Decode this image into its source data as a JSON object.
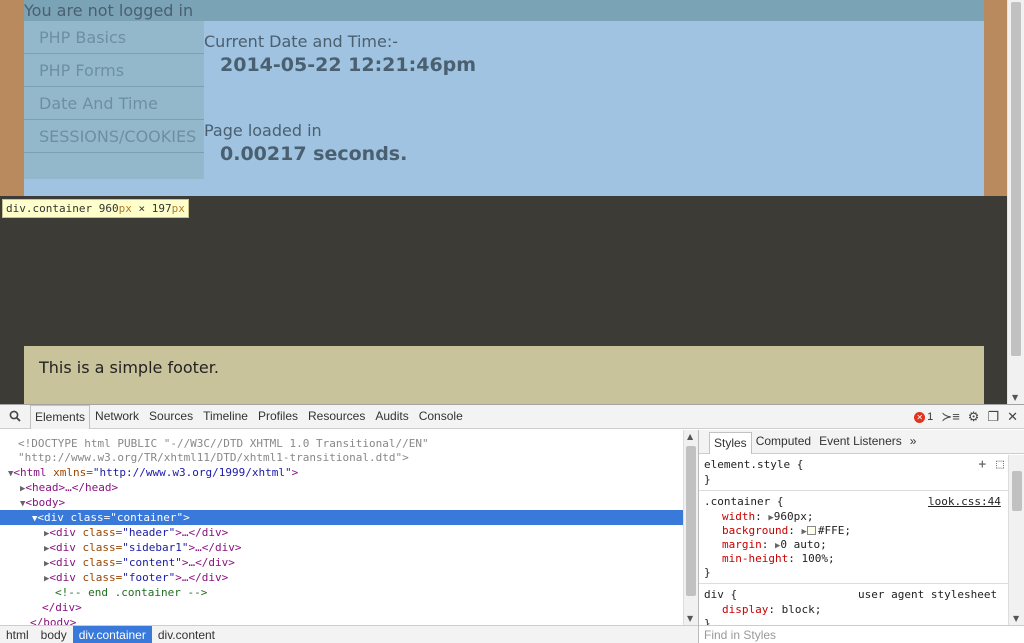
{
  "page": {
    "login_status": "You are not logged in",
    "nav": [
      "PHP Basics",
      "PHP Forms",
      "Date And Time",
      "SESSIONS/COOKIES"
    ],
    "date_label": "Current Date and Time:-",
    "date_value": "2014-05-22 12:21:46pm",
    "loaded_label": "Page loaded in",
    "loaded_value": "0.00217 seconds.",
    "footer": "This is a simple footer.",
    "tooltip": {
      "selector": "div.container",
      "w": "960",
      "h": "197",
      "unit": "px",
      "times": " × "
    }
  },
  "devtools": {
    "tabs": [
      "Elements",
      "Network",
      "Sources",
      "Timeline",
      "Profiles",
      "Resources",
      "Audits",
      "Console"
    ],
    "error_count": "1",
    "dom": {
      "doctype1": "<!DOCTYPE html PUBLIC \"-//W3C//DTD XHTML 1.0 Transitional//EN\"",
      "doctype2": "\"http://www.w3.org/TR/xhtml11/DTD/xhtml1-transitional.dtd\">",
      "html_tag": "<html",
      "html_attr": " xmlns=",
      "html_val": "\"http://www.w3.org/1999/xhtml\"",
      "html_close": ">",
      "head": "<head>…</head>",
      "body": "<body>",
      "container_open": "<div",
      "container_attr": " class=",
      "container_val": "\"container\"",
      "container_close": ">",
      "children": [
        {
          "cls": "\"header\""
        },
        {
          "cls": "\"sidebar1\""
        },
        {
          "cls": "\"content\""
        },
        {
          "cls": "\"footer\""
        }
      ],
      "child_open": "<div",
      "child_attr": " class=",
      "child_close": ">…</div>",
      "comment": "<!-- end .container -->",
      "div_end": "</div>",
      "body_end": "</body>"
    },
    "breadcrumbs": [
      "html",
      "body",
      "div.container",
      "div.content"
    ],
    "styles": {
      "tabs": [
        "Styles",
        "Computed",
        "Event Listeners"
      ],
      "more": "»",
      "element_style": "element.style {",
      "close_brace": "}",
      "rule_selector": ".container {",
      "rule_source": "look.css:44",
      "props": [
        {
          "name": "width",
          "value": "960px;"
        },
        {
          "name": "background",
          "value": "#FFE;"
        },
        {
          "name": "margin",
          "value": "0 auto;"
        },
        {
          "name": "min-height",
          "value": "100%;"
        }
      ],
      "ua_selector": "div {",
      "ua_source": "user agent stylesheet",
      "ua_prop": {
        "name": "display",
        "value": "block;"
      },
      "find_placeholder": "Find in Styles"
    }
  }
}
